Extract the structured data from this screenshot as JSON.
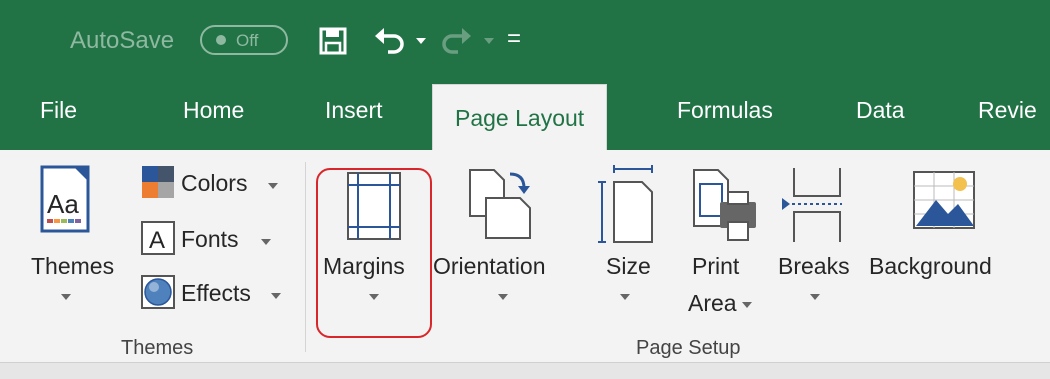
{
  "qat": {
    "autosave_label": "AutoSave",
    "autosave_state": "Off",
    "customize_glyph": "="
  },
  "tabs": [
    {
      "label": "File"
    },
    {
      "label": "Home"
    },
    {
      "label": "Insert"
    },
    {
      "label": "Page Layout",
      "active": true
    },
    {
      "label": "Formulas"
    },
    {
      "label": "Data"
    },
    {
      "label": "Revie"
    }
  ],
  "ribbon": {
    "themes_group": {
      "themes_button": "Themes",
      "colors": "Colors",
      "fonts": "Fonts",
      "effects": "Effects",
      "group_label": "Themes"
    },
    "page_setup_group": {
      "margins": "Margins",
      "orientation": "Orientation",
      "size": "Size",
      "print_area_line1": "Print",
      "print_area_line2": "Area",
      "breaks": "Breaks",
      "background": "Background",
      "group_label": "Page Setup"
    }
  },
  "colors": {
    "brand": "#217346",
    "highlight": "#d9262a"
  },
  "icons": [
    "save-icon",
    "undo-icon",
    "redo-icon",
    "themes-icon",
    "colors-icon",
    "fonts-icon",
    "effects-icon",
    "margins-icon",
    "orientation-icon",
    "size-icon",
    "print-area-icon",
    "breaks-icon",
    "background-icon"
  ]
}
